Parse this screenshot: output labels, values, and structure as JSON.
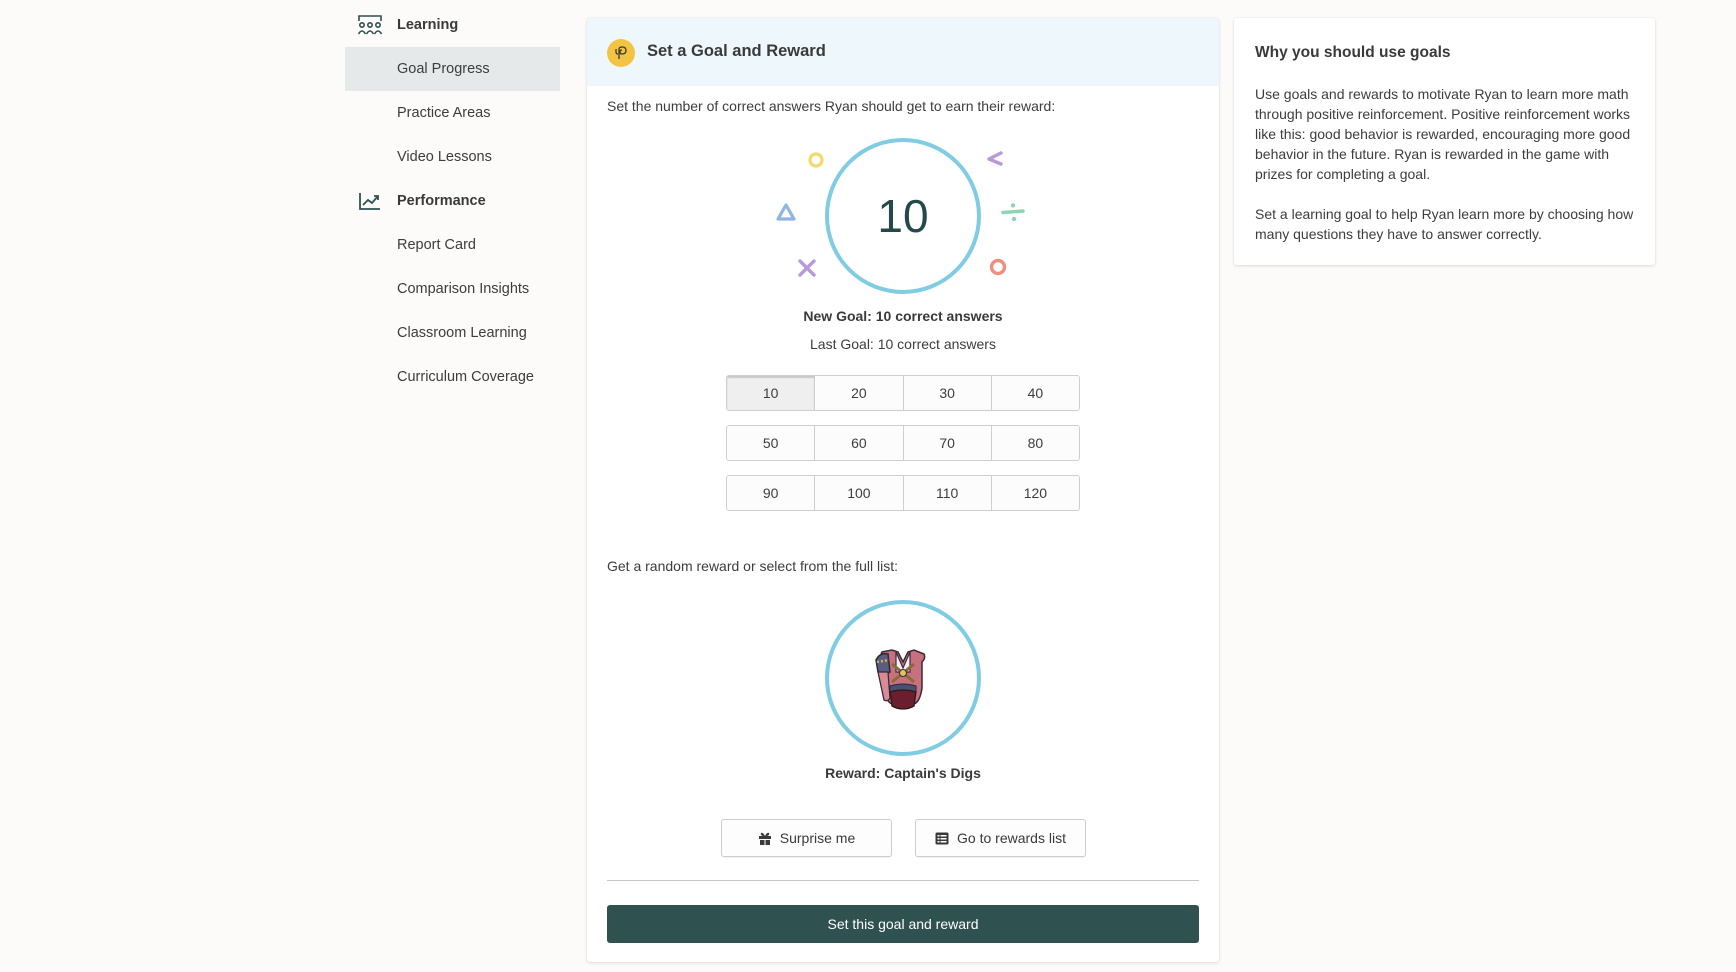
{
  "sidebar": {
    "sections": [
      {
        "label": "Learning",
        "icon": "classroom-icon",
        "items": [
          {
            "label": "Goal Progress",
            "active": true
          },
          {
            "label": "Practice Areas",
            "active": false
          },
          {
            "label": "Video Lessons",
            "active": false
          }
        ]
      },
      {
        "label": "Performance",
        "icon": "trend-chart-icon",
        "items": [
          {
            "label": "Report Card",
            "active": false
          },
          {
            "label": "Comparison Insights",
            "active": false
          },
          {
            "label": "Classroom Learning",
            "active": false
          },
          {
            "label": "Curriculum Coverage",
            "active": false
          }
        ]
      }
    ]
  },
  "main": {
    "header": {
      "title": "Set a Goal and Reward",
      "icon": "prodigy-logo-icon"
    },
    "goal_prompt": "Set the number of correct answers Ryan should get to earn their reward:",
    "goal_value": "10",
    "new_goal": "New Goal: 10 correct answers",
    "last_goal": "Last Goal: 10 correct answers",
    "goal_options": [
      [
        "10",
        "20",
        "30",
        "40"
      ],
      [
        "50",
        "60",
        "70",
        "80"
      ],
      [
        "90",
        "100",
        "110",
        "120"
      ]
    ],
    "selected_goal": "10",
    "reward_prompt": "Get a random reward or select from the full list:",
    "reward_label": "Reward: Captain's Digs",
    "surprise_button": "Surprise me",
    "rewards_list_button": "Go to rewards list",
    "submit_button": "Set this goal and reward"
  },
  "info": {
    "title": "Why you should use goals",
    "paragraphs": [
      "Use goals and rewards to motivate Ryan to learn more math through positive reinforcement. Positive reinforcement works like this: good behavior is rewarded, encouraging more good behavior in the future. Ryan is rewarded in the game with prizes for completing a goal.",
      "Set a learning goal to help Ryan learn more by choosing how many questions they have to answer correctly."
    ]
  },
  "colors": {
    "accent_dark": "#2f5150",
    "circle_ring": "#7fcce3",
    "header_bg": "#eef7fb",
    "logo_yellow": "#f3c443",
    "active_nav": "#e6e9ea"
  }
}
